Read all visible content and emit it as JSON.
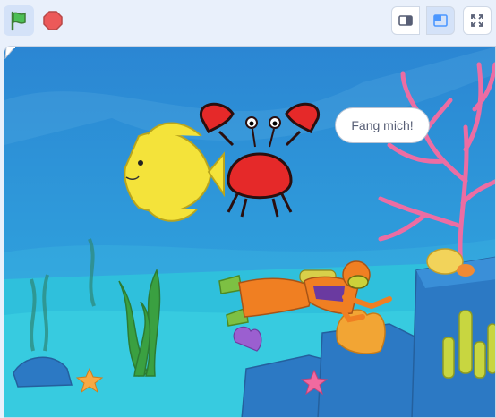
{
  "toolbar": {
    "green_flag_icon": "green-flag-icon",
    "stop_icon": "stop-sign-icon",
    "small_stage_icon": "small-stage-icon",
    "normal_stage_icon": "normal-stage-icon",
    "fullscreen_icon": "fullscreen-icon"
  },
  "stage": {
    "speech_bubble_text": "Fang mich!",
    "sprites": [
      "fish",
      "crab",
      "diver"
    ],
    "backdrop": "underwater"
  },
  "colors": {
    "accent": "#4c97ff",
    "flag_green": "#45993d",
    "stop_red": "#ec5959",
    "water_top": "#2f8fd6",
    "water_bottom": "#2ab6d8"
  }
}
